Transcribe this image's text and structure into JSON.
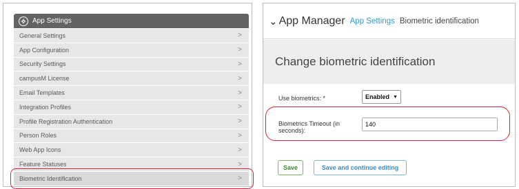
{
  "left_panel": {
    "header": {
      "title": "App Settings",
      "icon": "gear-icon"
    },
    "menu_items": [
      {
        "label": "General Settings",
        "chevron": ">"
      },
      {
        "label": "App Configuration",
        "chevron": ">"
      },
      {
        "label": "Security Settings",
        "chevron": ">"
      },
      {
        "label": "campusM License",
        "chevron": ">"
      },
      {
        "label": "Email Templates",
        "chevron": ">"
      },
      {
        "label": "Integration Profiles",
        "chevron": ">"
      },
      {
        "label": "Profile Registration Authentication",
        "chevron": ">"
      },
      {
        "label": "Person Roles",
        "chevron": ">"
      },
      {
        "label": "Web App Icons",
        "chevron": ">"
      },
      {
        "label": "Feature Statuses",
        "chevron": ">"
      },
      {
        "label": "Biometric Identification",
        "chevron": ">"
      }
    ]
  },
  "right_panel": {
    "breadcrumb": {
      "chevron": "⌄",
      "title": "App Manager",
      "link": "App Settings",
      "current": "Biometric identification"
    },
    "heading": "Change biometric identification",
    "form": {
      "biometrics_label": "Use biometrics: *",
      "biometrics_value": "Enabled",
      "biometrics_arrow": "▼",
      "timeout_label": "Biometrics Timeout (in seconds):",
      "timeout_value": "140"
    },
    "buttons": {
      "save": "Save",
      "save_continue": "Save and continue editing"
    }
  },
  "colors": {
    "header_bg": "#636363",
    "link": "#3399cc",
    "highlight_oval": "#d9232e",
    "save_border": "#7ab55c",
    "continue_border": "#7ab8dc"
  }
}
